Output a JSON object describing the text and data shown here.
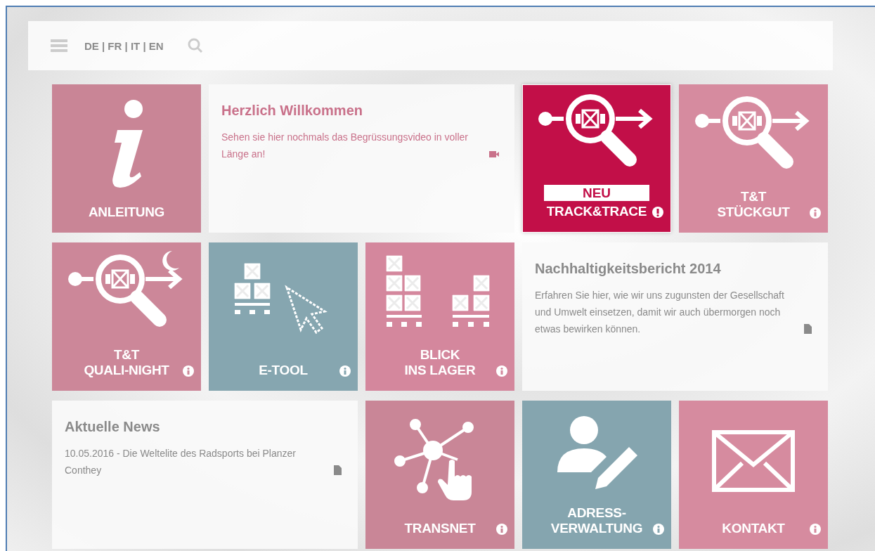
{
  "header": {
    "languages": "DE | FR | IT | EN"
  },
  "tiles": [
    {
      "kind": "icon",
      "label": [
        "ANLEITUNG"
      ],
      "color": "#c98596",
      "highlighted": false
    },
    {
      "kind": "text",
      "title": "Herzlich Willkommen",
      "text": "Sehen sie hier nochmals das Begrüssungsvideo in voller Länge an!",
      "color": "#c9718a"
    },
    {
      "kind": "icon",
      "badge": "NEU",
      "label": [
        "TRACK&TRACE"
      ],
      "color": "#c20f48",
      "highlighted": true
    },
    {
      "kind": "icon",
      "label": [
        "T&T",
        "STÜCKGUT"
      ],
      "color": "#d68b9f",
      "highlighted": false
    },
    {
      "kind": "icon",
      "label": [
        "T&T",
        "QUALI-NIGHT"
      ],
      "color": "#cc8799",
      "highlighted": false
    },
    {
      "kind": "icon",
      "label": [
        "E-TOOL"
      ],
      "color": "#86a6b0",
      "highlighted": false
    },
    {
      "kind": "icon",
      "label": [
        "BLICK",
        "INS LAGER"
      ],
      "color": "#d4879d",
      "highlighted": false
    },
    {
      "kind": "text",
      "title": "Nachhaltigkeitsbericht 2014",
      "text": "Erfahren Sie hier, wie wir uns zugunsten der Gesellschaft und Umwelt einsetzen, damit wir auch übermorgen noch etwas bewirken können.",
      "color": "#8a8a8a"
    },
    {
      "kind": "text",
      "title": "Aktuelle News",
      "text": "10.05.2016 - Die Weltelite des Radsports bei Planzer Conthey",
      "color": "#8a8a8a"
    },
    {
      "kind": "icon",
      "label": [
        "TRANSNET"
      ],
      "color": "#c98697",
      "highlighted": false
    },
    {
      "kind": "icon",
      "label": [
        "ADRESS-",
        "VERWALTUNG"
      ],
      "color": "#85a5af",
      "highlighted": false
    },
    {
      "kind": "icon",
      "label": [
        "KONTAKT"
      ],
      "color": "#d68b9f",
      "highlighted": false
    }
  ]
}
